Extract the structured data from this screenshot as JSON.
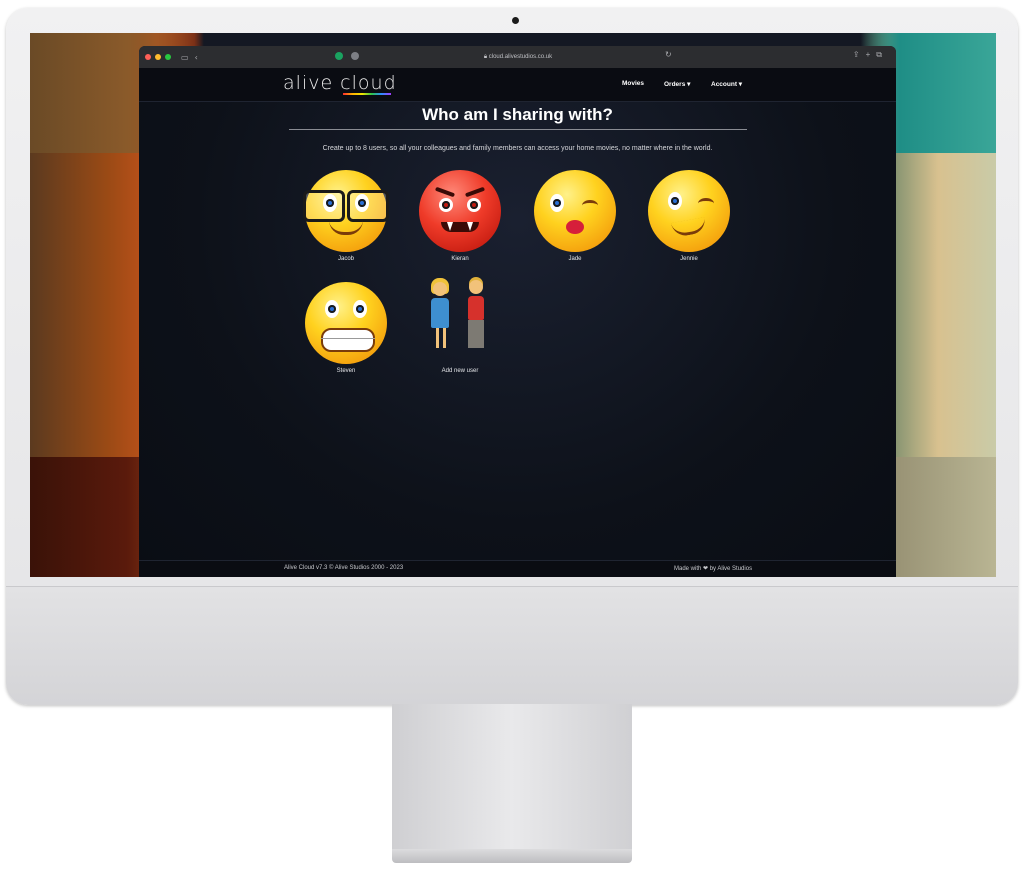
{
  "browser": {
    "url": "cloud.alivestudios.co.uk"
  },
  "site": {
    "logo": "alive cloud",
    "nav": {
      "movies": "Movies",
      "orders": "Orders ▾",
      "account": "Account ▾"
    },
    "page_title": "Who am I sharing with?",
    "subtitle": "Create up to 8 users, so all your colleagues and family members can access your home movies, no matter where in the world.",
    "users": [
      {
        "name": "Jacob",
        "icon": "nerd-face-icon"
      },
      {
        "name": "Kieran",
        "icon": "devil-face-icon"
      },
      {
        "name": "Jade",
        "icon": "kiss-face-icon"
      },
      {
        "name": "Jennie",
        "icon": "wink-face-icon"
      },
      {
        "name": "Steven",
        "icon": "grimace-face-icon"
      }
    ],
    "add_user": {
      "label": "Add new user",
      "icon": "couple-icon"
    },
    "footer": {
      "left": "Alive Cloud v7.3 © Alive Studios 2000 - 2023",
      "right": "Made with ❤ by Alive Studios"
    }
  },
  "colors": {
    "accent_heart": "#e0245e",
    "background": "#0d1119"
  }
}
